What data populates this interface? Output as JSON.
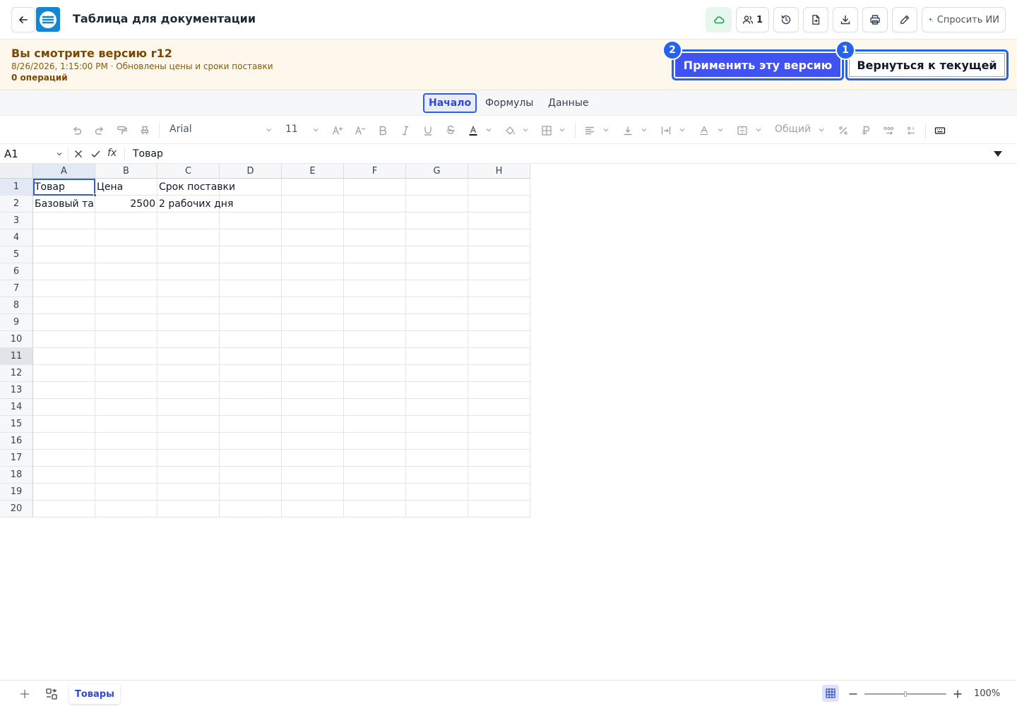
{
  "header": {
    "title": "Таблица для документации",
    "collaborators_count": "1",
    "ask_ai_label": "Спросить ИИ"
  },
  "banner": {
    "title": "Вы смотрите версию r12",
    "subtitle": "8/26/2026, 1:15:00 PM · Обновлены цены и сроки поставки",
    "operations": "0 операций",
    "apply_label": "Применить эту версию",
    "apply_badge": "2",
    "revert_label": "Вернуться к текущей",
    "revert_badge": "1"
  },
  "ribbon_tabs": [
    "Начало",
    "Формулы",
    "Данные"
  ],
  "toolbar": {
    "font_name": "Arial",
    "font_size": "11",
    "number_format": "Общий"
  },
  "formula_bar": {
    "cell_ref": "A1",
    "fx_label": "fx",
    "value": "Товар"
  },
  "grid": {
    "columns": [
      "A",
      "B",
      "C",
      "D",
      "E",
      "F",
      "G",
      "H"
    ],
    "rows": [
      "1",
      "2",
      "3",
      "4",
      "5",
      "6",
      "7",
      "8",
      "9",
      "10",
      "11",
      "12",
      "13",
      "14",
      "15",
      "16",
      "17",
      "18",
      "19",
      "20"
    ],
    "cells": {
      "A1": "Товар",
      "B1": "Цена",
      "C1": "Срок поставки",
      "A2": "Базовый та",
      "B2": "2500",
      "C2": "2 рабочих дня"
    },
    "active_cell": "A1",
    "highlighted_row": "11"
  },
  "bottom_bar": {
    "sheet_tab": "Товары",
    "zoom": "100%",
    "zoom_level": 0.5
  },
  "colors": {
    "accent": "#2f48d4",
    "apply_bg": "#4052ef",
    "focus_ring": "#2563eb",
    "banner_bg": "#fef8ec",
    "banner_text": "#7a4a05",
    "cloud_ok": "#16a34a"
  }
}
